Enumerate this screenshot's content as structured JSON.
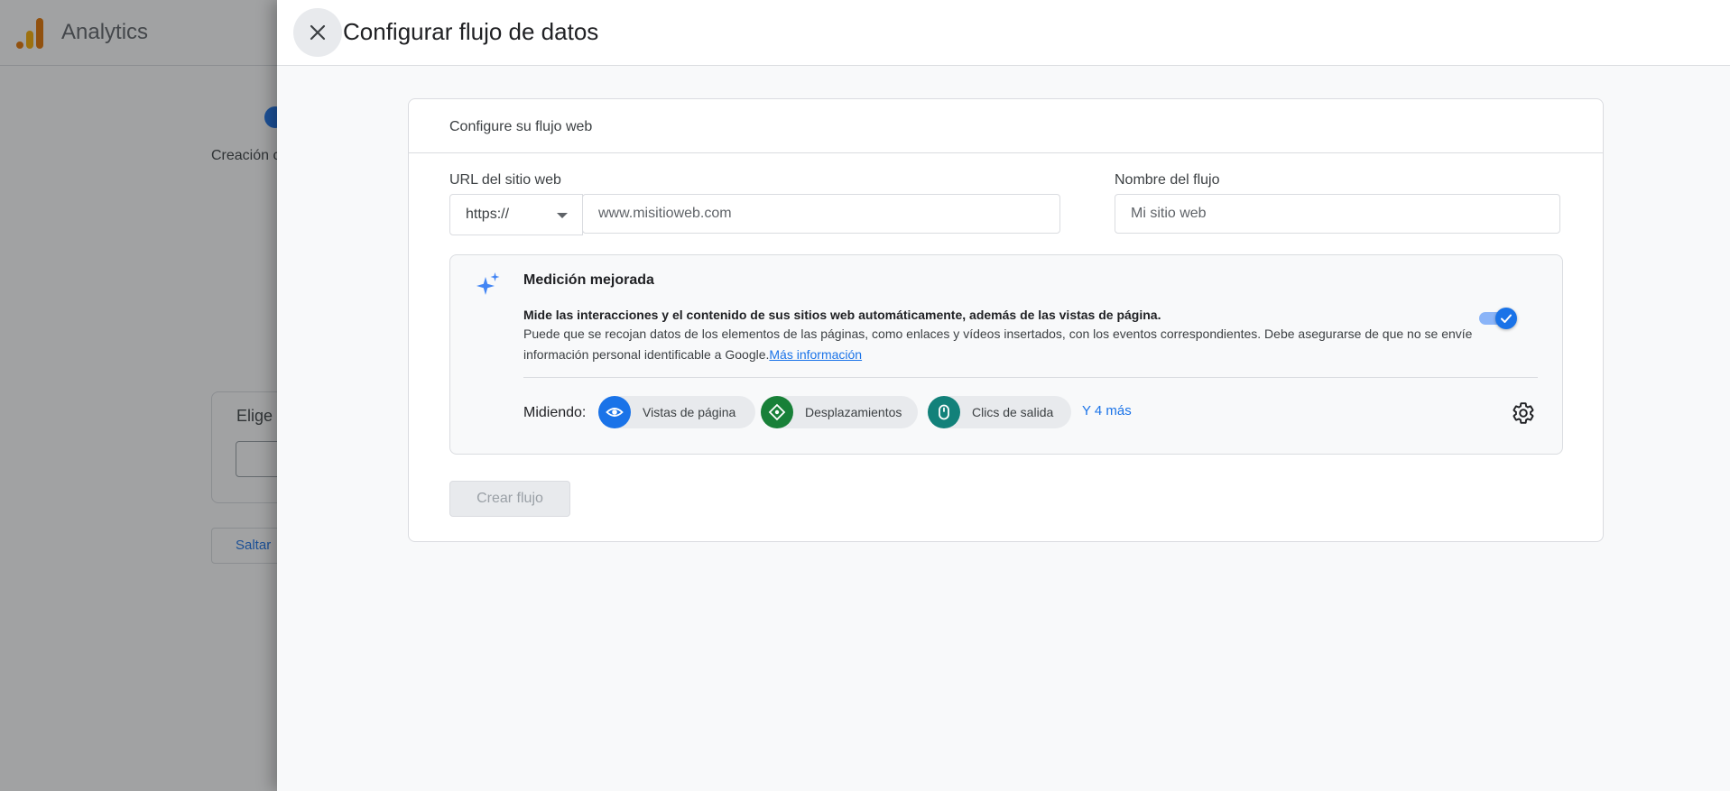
{
  "app": {
    "title": "Analytics"
  },
  "background": {
    "step_label": "Creación c",
    "card_title": "Elige u",
    "skip_button": "Saltar"
  },
  "dialog": {
    "title": "Configurar flujo de datos",
    "close_icon": "close-icon"
  },
  "card": {
    "header": "Configure su flujo web",
    "url_label": "URL del sitio web",
    "protocol_value": "https://",
    "url_placeholder": "www.misitioweb.com",
    "stream_name_label": "Nombre del flujo",
    "stream_name_placeholder": "Mi sitio web",
    "create_button": "Crear flujo"
  },
  "enhanced_measurement": {
    "title": "Medición mejorada",
    "bold_text": "Mide las interacciones y el contenido de sus sitios web automáticamente, además de las vistas de página.",
    "description": "Puede que se recojan datos de los elementos de las páginas, como enlaces y vídeos insertados, con los eventos correspondientes. Debe asegurarse de que no se envíe información personal identificable a Google.",
    "learn_more": "Más información",
    "toggle_on": true,
    "measuring_label": "Midiendo:",
    "chips": [
      {
        "label": "Vistas de página",
        "icon": "eye-icon",
        "color": "#1a73e8"
      },
      {
        "label": "Desplazamientos",
        "icon": "scroll-icon",
        "color": "#188038"
      },
      {
        "label": "Clics de salida",
        "icon": "mouse-icon",
        "color": "#12817a"
      }
    ],
    "more_link": "Y 4 más"
  },
  "colors": {
    "accent": "#1a73e8",
    "analytics_orange": "#e37400",
    "analytics_yellow": "#f9ab00"
  }
}
